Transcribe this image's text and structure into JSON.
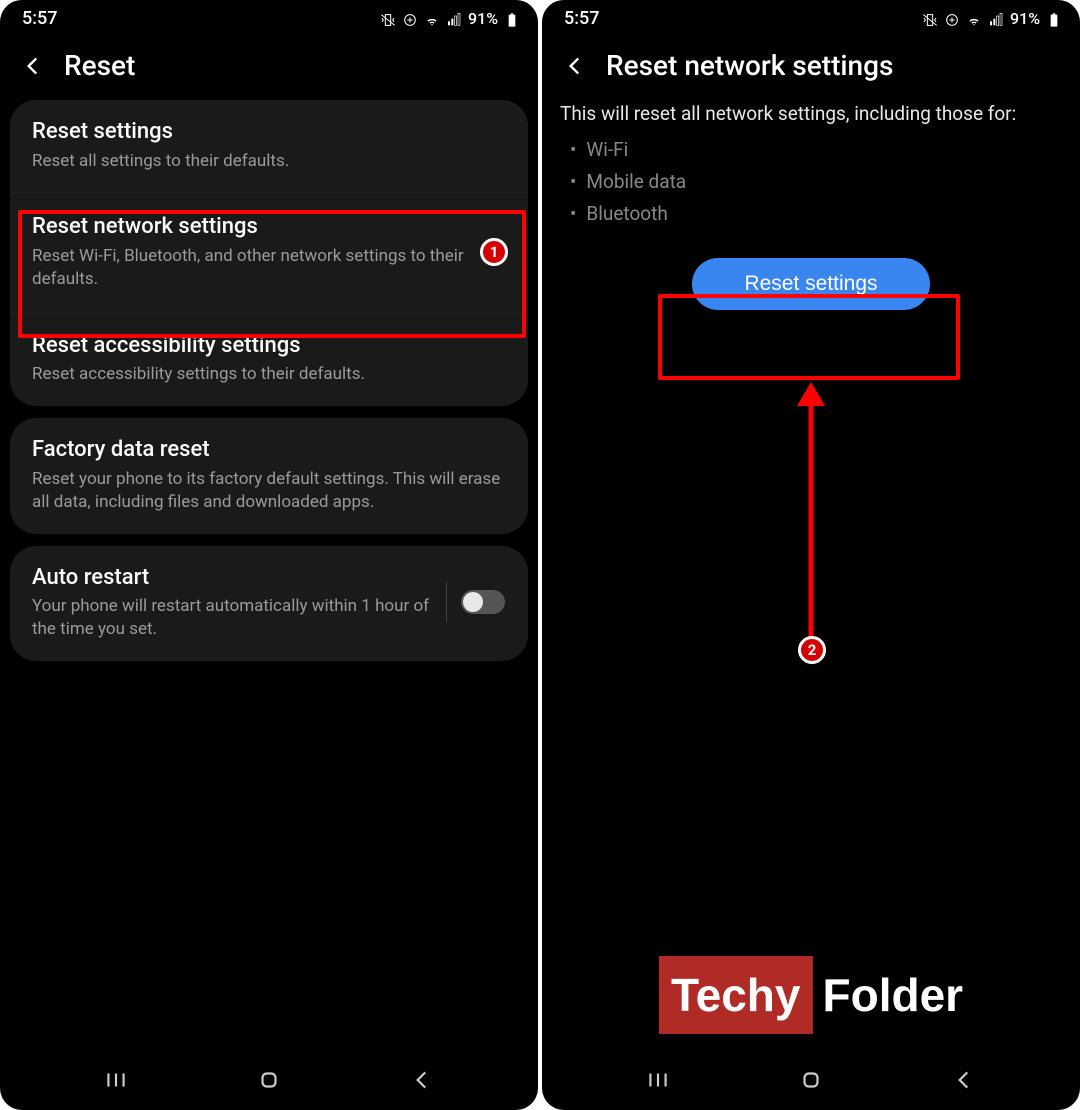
{
  "status": {
    "time": "5:57",
    "battery": "91%"
  },
  "left": {
    "title": "Reset",
    "card1": [
      {
        "title": "Reset settings",
        "sub": "Reset all settings to their defaults."
      },
      {
        "title": "Reset network settings",
        "sub": "Reset Wi-Fi, Bluetooth, and other network settings to their defaults."
      },
      {
        "title": "Reset accessibility settings",
        "sub": "Reset accessibility settings to their defaults."
      }
    ],
    "card2": [
      {
        "title": "Factory data reset",
        "sub": "Reset your phone to its factory default settings. This will erase all data, including files and downloaded apps."
      }
    ],
    "card3": [
      {
        "title": "Auto restart",
        "sub": "Your phone will restart automatically within 1 hour of the time you set."
      }
    ]
  },
  "right": {
    "title": "Reset network settings",
    "intro": "This will reset all network settings, including those for:",
    "bullets": [
      "Wi-Fi",
      "Mobile data",
      "Bluetooth"
    ],
    "button": "Reset settings"
  },
  "annotations": {
    "badge1": "1",
    "badge2": "2"
  },
  "watermark": {
    "a": "Techy",
    "b": "Folder"
  }
}
